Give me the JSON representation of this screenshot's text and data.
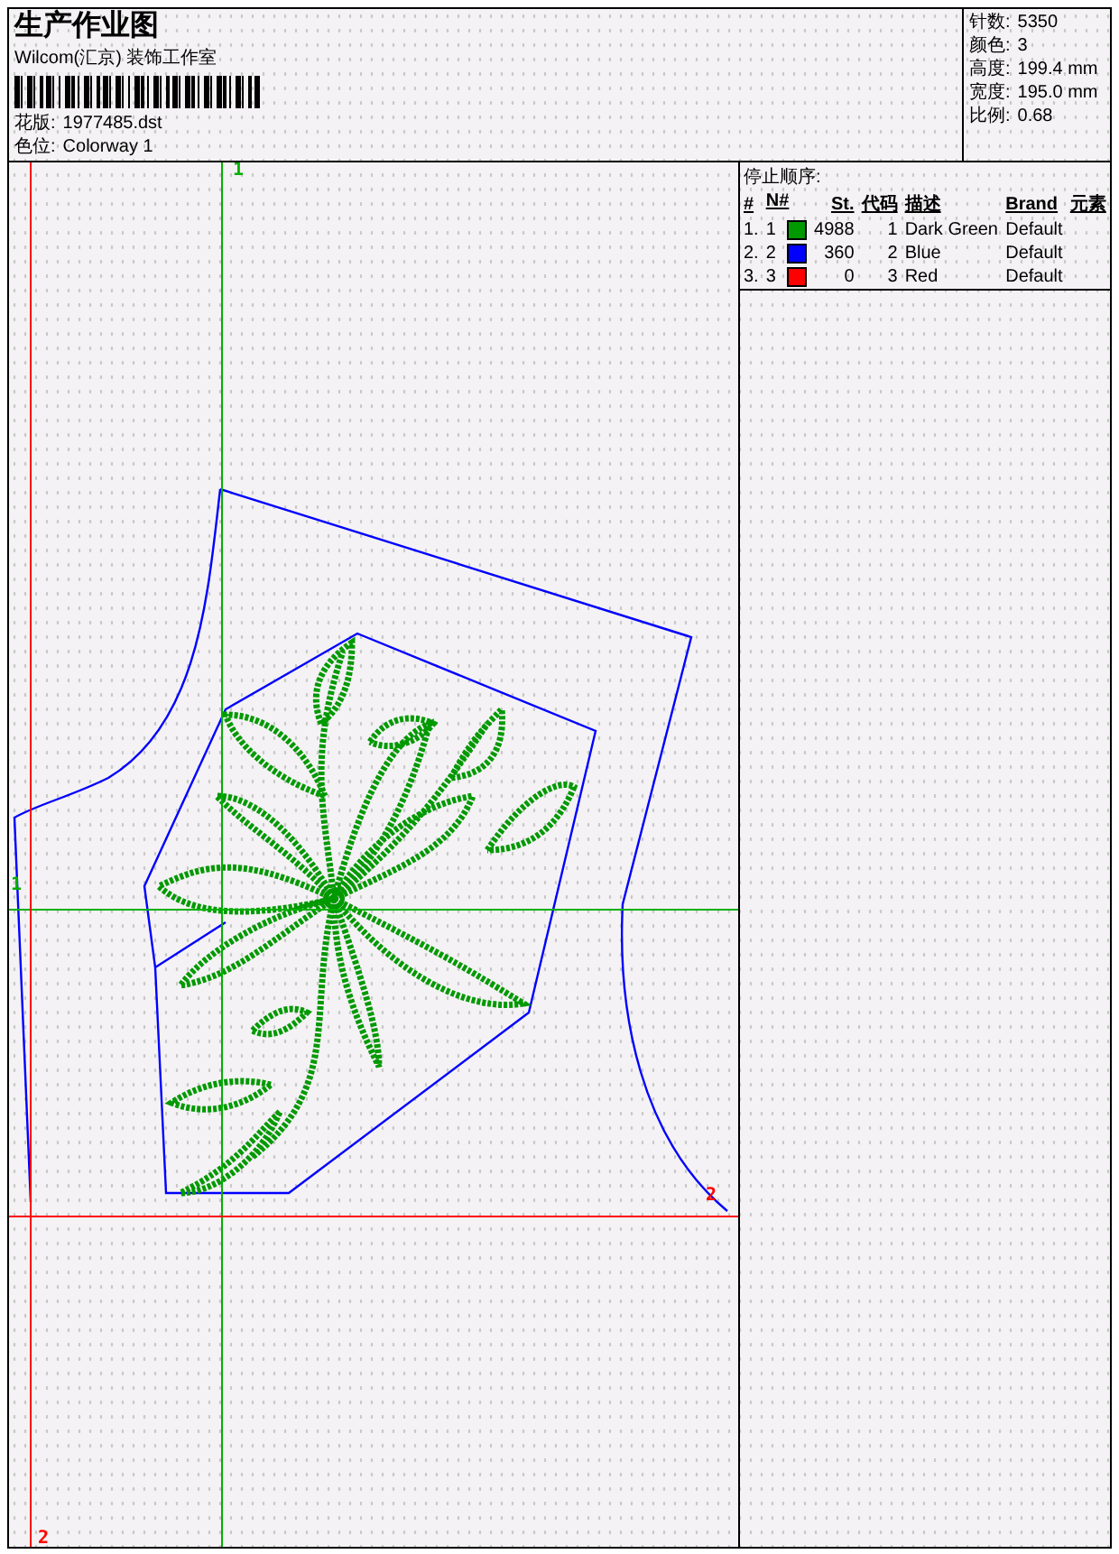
{
  "header": {
    "title": "生产作业图",
    "company": "Wilcom(汇京) 装饰工作室",
    "design": {
      "label": "花版:",
      "value": "1977485.dst"
    },
    "colorway": {
      "label": "色位:",
      "value": "Colorway 1"
    }
  },
  "stats": [
    {
      "label": "针数:",
      "value": "5350"
    },
    {
      "label": "颜色:",
      "value": "3"
    },
    {
      "label": "高度:",
      "value": "199.4 mm"
    },
    {
      "label": "宽度:",
      "value": "195.0 mm"
    },
    {
      "label": "比例:",
      "value": "0.68"
    }
  ],
  "canvas": {
    "guides": [
      {
        "label": "1",
        "color": "#00b000"
      },
      {
        "label": "1",
        "color": "#00b000"
      },
      {
        "label": "2",
        "color": "#ff0000"
      },
      {
        "label": "2",
        "color": "#ff0000"
      }
    ]
  },
  "stop_sequence": {
    "title": "停止顺序:",
    "columns": [
      "#",
      "N#",
      "St.",
      "代码",
      "描述",
      "Brand",
      "元素"
    ],
    "rows": [
      {
        "index": "1.",
        "number": "1",
        "color": "#009900",
        "stitches": "4988",
        "code": "1",
        "description": "Dark Green",
        "brand": "Default"
      },
      {
        "index": "2.",
        "number": "2",
        "color": "#0000ff",
        "stitches": "360",
        "code": "2",
        "description": "Blue",
        "brand": "Default"
      },
      {
        "index": "3.",
        "number": "3",
        "color": "#ff0000",
        "stitches": "0",
        "code": "3",
        "description": "Red",
        "brand": "Default"
      }
    ]
  }
}
